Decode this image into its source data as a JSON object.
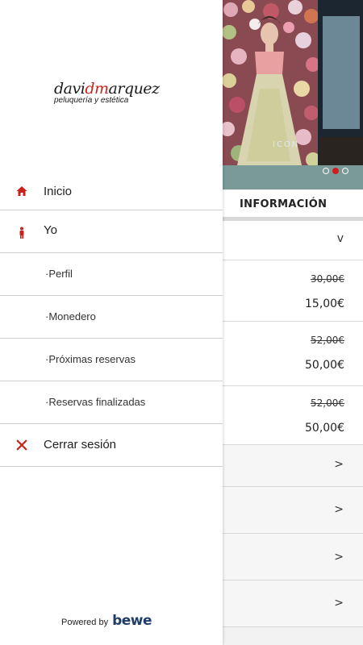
{
  "drawer": {
    "logo": {
      "name_part1": "davi",
      "name_part2": "dm",
      "name_part3": "arquez",
      "tagline": "peluquería y estética"
    },
    "items": [
      {
        "label": "Inicio",
        "icon": "home-icon"
      },
      {
        "label": "Yo",
        "icon": "person-icon"
      },
      {
        "label": "·Perfil"
      },
      {
        "label": "·Monedero"
      },
      {
        "label": "·Próximas reservas"
      },
      {
        "label": "·Reservas finalizadas"
      },
      {
        "label": "Cerrar sesión",
        "icon": "close-icon"
      }
    ],
    "footer": {
      "powered_by": "Powered by",
      "brand": "bewe"
    }
  },
  "main": {
    "info_tab": "INFORMACIÓN",
    "prices": [
      {
        "old": "30,00€",
        "new": "15,00€"
      },
      {
        "old": "52,00€",
        "new": "50,00€"
      },
      {
        "old": "52,00€",
        "new": "50,00€"
      }
    ],
    "chevrons": {
      "down": "v",
      "right": ">"
    },
    "carousel": {
      "slides": 3,
      "active_index": 1
    }
  },
  "colors": {
    "accent": "#c9221b",
    "divider": "#d0d0d0",
    "brand": "#1f3d66"
  }
}
